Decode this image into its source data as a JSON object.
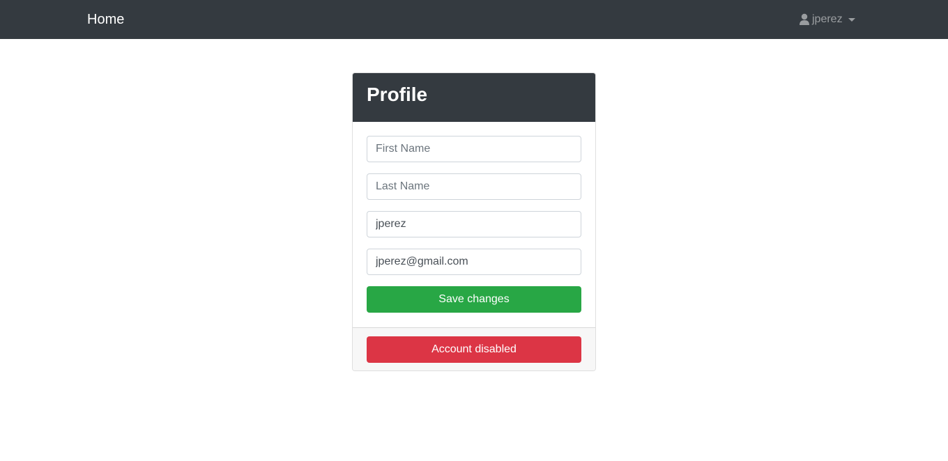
{
  "navbar": {
    "brand": "Home",
    "user": {
      "icon": "user-icon",
      "username": "jperez"
    }
  },
  "profile": {
    "title": "Profile",
    "fields": {
      "first_name": {
        "placeholder": "First Name",
        "value": ""
      },
      "last_name": {
        "placeholder": "Last Name",
        "value": ""
      },
      "username": {
        "placeholder": "",
        "value": "jperez"
      },
      "email": {
        "placeholder": "",
        "value": "jperez@gmail.com"
      }
    },
    "save_label": "Save changes",
    "account_status_label": "Account disabled"
  },
  "colors": {
    "navbar_bg": "#343a40",
    "success": "#28a745",
    "danger": "#dc3545"
  }
}
